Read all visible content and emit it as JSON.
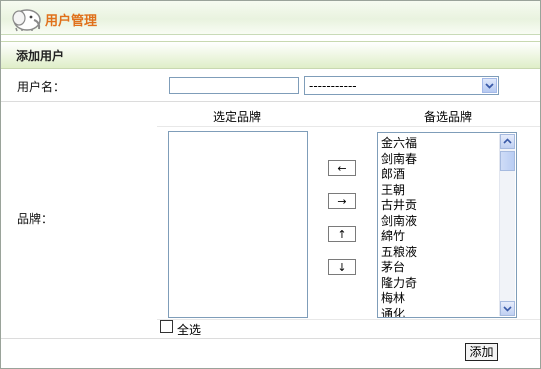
{
  "header": {
    "title": "用户管理",
    "logo_icon": "elephant-logo-icon"
  },
  "section": {
    "title": "添加用户"
  },
  "form": {
    "username_label": "用户名：",
    "username_value": "",
    "select_value": "-----------",
    "brand_label": "品牌：",
    "selected_header": "选定品牌",
    "available_header": "备选品牌",
    "available_brands": [
      "金六福",
      "剑南春",
      "郎酒",
      "王朝",
      "古井贡",
      "剑南液",
      "綿竹",
      "五粮液",
      "茅台",
      "隆力奇",
      "梅林",
      "通化"
    ],
    "arrows": {
      "left": "←",
      "right": "→",
      "up": "↑",
      "down": "↓"
    },
    "select_all_label": "全选",
    "select_all_checked": false,
    "add_button_label": "添加"
  },
  "colors": {
    "title_orange": "#e0701a",
    "border_blue": "#7f9db9",
    "header_green": "#dfeec8"
  }
}
